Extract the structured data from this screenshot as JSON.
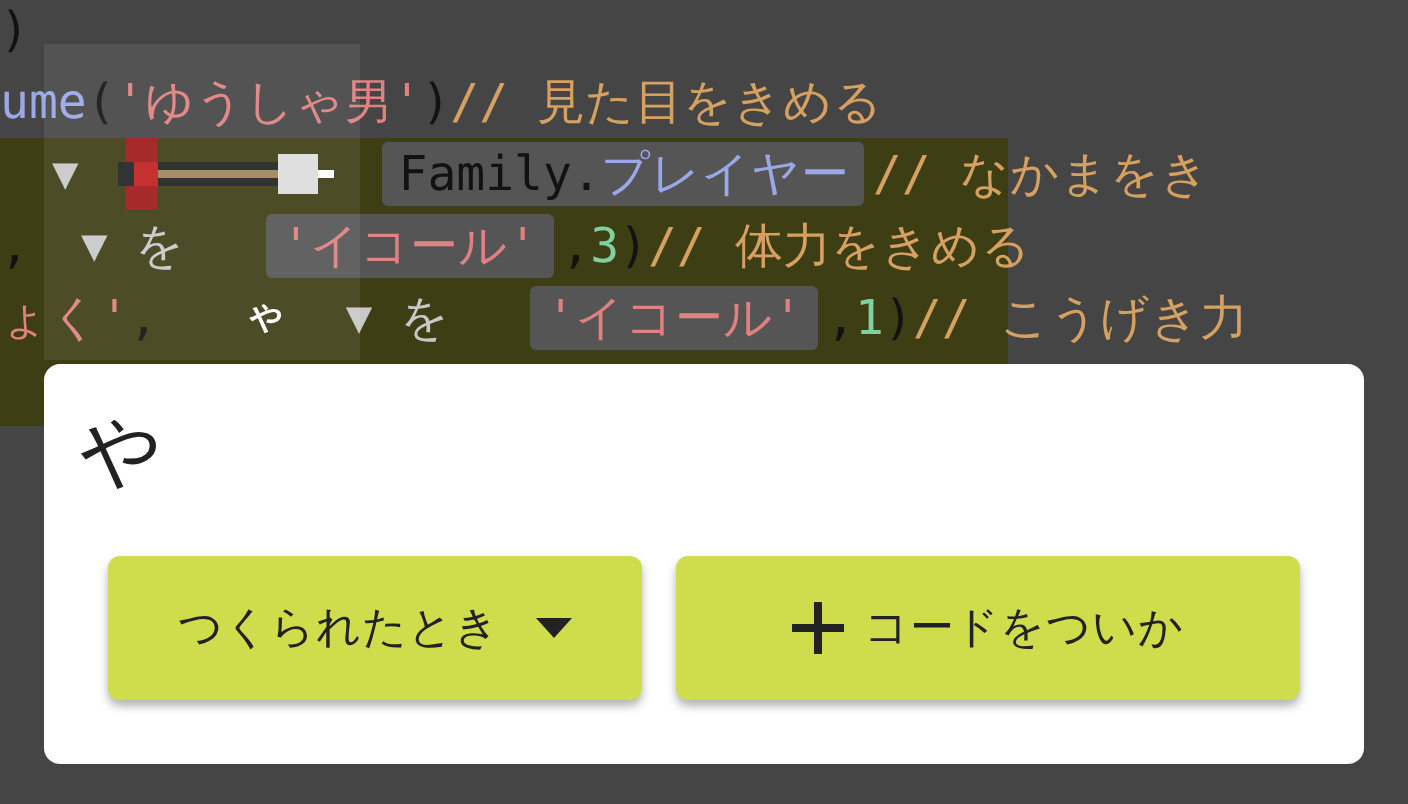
{
  "editor": {
    "lines": [
      {
        "highlighted": false,
        "tokens": [
          {
            "kind": "plain",
            "text": ")"
          }
        ]
      },
      {
        "highlighted": false,
        "tokens": [
          {
            "kind": "keyword",
            "text": "ume"
          },
          {
            "kind": "plain",
            "text": "("
          },
          {
            "kind": "string",
            "text": "'ゆうしゃ男'"
          },
          {
            "kind": "plain",
            "text": ") "
          },
          {
            "kind": "comment",
            "text": "// 見た目をきめる"
          }
        ]
      },
      {
        "highlighted": true,
        "tokens": [
          {
            "kind": "arrow",
            "text": "▼"
          },
          {
            "kind": "sprite"
          },
          {
            "kind": "chip",
            "parts": [
              {
                "kind": "plain",
                "text": "Family."
              },
              {
                "kind": "keyword",
                "text": "プレイヤー"
              }
            ]
          },
          {
            "kind": "comment",
            "text": " // なかまをき"
          }
        ]
      },
      {
        "highlighted": true,
        "tokens": [
          {
            "kind": "plain",
            "text": ","
          },
          {
            "kind": "arrow",
            "text": "▼"
          },
          {
            "kind": "particle",
            "text": "を"
          },
          {
            "kind": "chip",
            "parts": [
              {
                "kind": "string",
                "text": "'イコール'"
              }
            ]
          },
          {
            "kind": "plain",
            "text": ", "
          },
          {
            "kind": "number",
            "text": "3"
          },
          {
            "kind": "plain",
            "text": ") "
          },
          {
            "kind": "comment",
            "text": "// 体力をきめる"
          }
        ]
      },
      {
        "highlighted": true,
        "tokens": [
          {
            "kind": "string",
            "text": "ょく'"
          },
          {
            "kind": "plain",
            "text": ","
          },
          {
            "kind": "label",
            "text": "や"
          },
          {
            "kind": "arrow",
            "text": "▼"
          },
          {
            "kind": "particle",
            "text": "を"
          },
          {
            "kind": "chip",
            "parts": [
              {
                "kind": "string",
                "text": "'イコール'"
              }
            ]
          },
          {
            "kind": "plain",
            "text": ", "
          },
          {
            "kind": "number",
            "text": "1"
          },
          {
            "kind": "plain",
            "text": ") "
          },
          {
            "kind": "comment",
            "text": "// こうげき力"
          }
        ]
      },
      {
        "highlighted": true
      }
    ]
  },
  "dialog": {
    "title": "や",
    "event_select": {
      "label": "つくられたとき"
    },
    "add_button": {
      "label": "コードをついか"
    }
  }
}
